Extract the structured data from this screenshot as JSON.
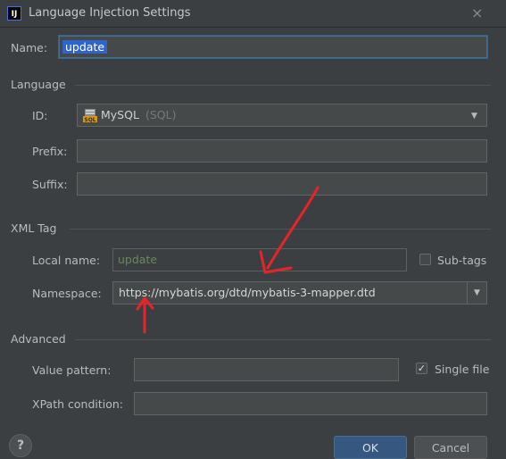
{
  "window": {
    "title": "Language Injection Settings",
    "app_icon": "IJ",
    "close_glyph": "×"
  },
  "name": {
    "label": "Name:",
    "value": "update"
  },
  "language": {
    "section": "Language",
    "id_label": "ID:",
    "id_value": "MySQL",
    "id_suffix": "(SQL)",
    "id_icon": "sql-database-icon",
    "prefix_label": "Prefix:",
    "prefix_value": "",
    "suffix_label": "Suffix:",
    "suffix_value": ""
  },
  "xml_tag": {
    "section": "XML Tag",
    "local_name_label": "Local name:",
    "local_name_value": "update",
    "subtags_label": "Sub-tags",
    "subtags_checked": false,
    "namespace_label": "Namespace:",
    "namespace_value": "https://mybatis.org/dtd/mybatis-3-mapper.dtd"
  },
  "advanced": {
    "section": "Advanced",
    "value_pattern_label": "Value pattern:",
    "value_pattern_value": "",
    "single_file_label": "Single file",
    "single_file_checked": true,
    "xpath_label": "XPath condition:",
    "xpath_value": ""
  },
  "footer": {
    "help_label": "?",
    "ok_label": "OK",
    "cancel_label": "Cancel"
  },
  "colors": {
    "accent": "#2f65ca",
    "annotation": "#e8232a",
    "green_text": "#6a8759",
    "background": "#3c3f41"
  }
}
